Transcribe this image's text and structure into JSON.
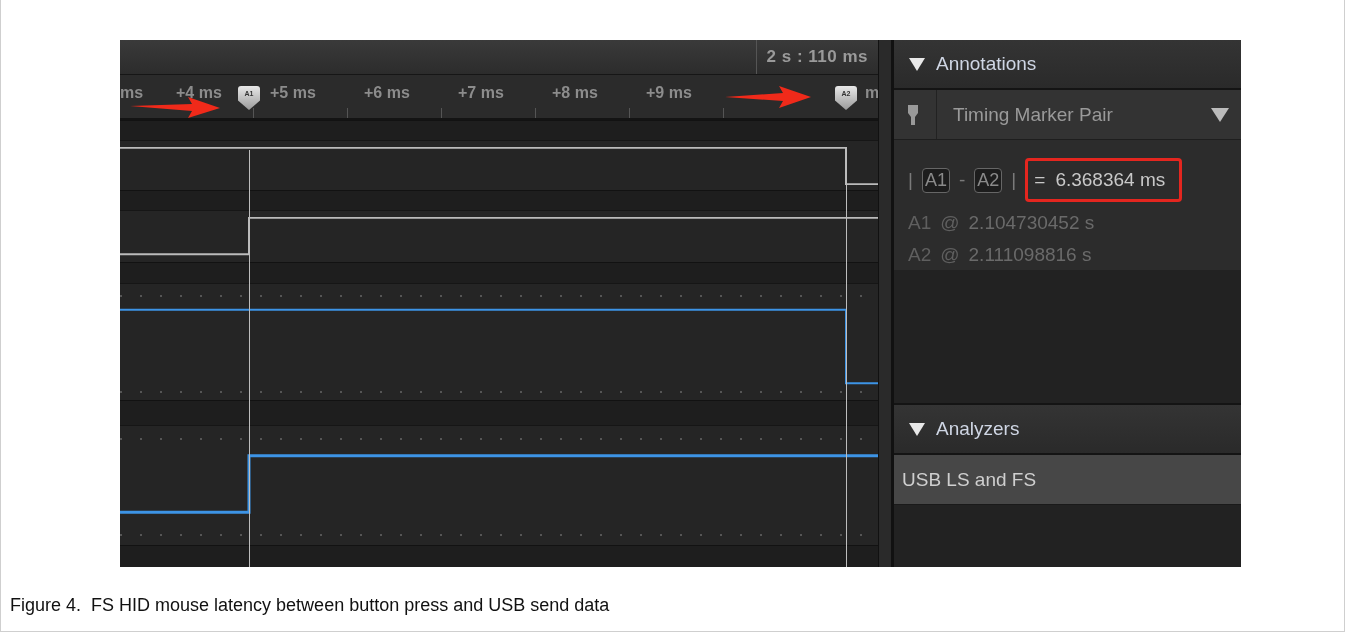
{
  "figure": {
    "timeline": {
      "time_label": "2 s : 110 ms",
      "ticks": [
        "ms",
        "+4 ms",
        "+5 ms",
        "+6 ms",
        "+7 ms",
        "+8 ms",
        "+9 ms",
        "m"
      ],
      "markers": [
        {
          "label": "A1"
        },
        {
          "label": "A2"
        }
      ]
    },
    "annotations": {
      "title": "Annotations",
      "expanded": true,
      "marker_type": "Timing Marker Pair",
      "difference": {
        "open_bar": "|",
        "a": "A1",
        "minus": "-",
        "b": "A2",
        "close_bar": "|",
        "equals": "=",
        "value": "6.368364 ms"
      },
      "positions": [
        {
          "marker": "A1",
          "at": "@",
          "time": "2.104730452 s"
        },
        {
          "marker": "A2",
          "at": "@",
          "time": "2.111098816 s"
        }
      ]
    },
    "analyzers": {
      "title": "Analyzers",
      "expanded": true,
      "items": [
        {
          "label": "USB LS and FS",
          "selected": true
        }
      ]
    }
  },
  "caption": "Figure 4.  FS HID mouse latency between button press and USB send data"
}
